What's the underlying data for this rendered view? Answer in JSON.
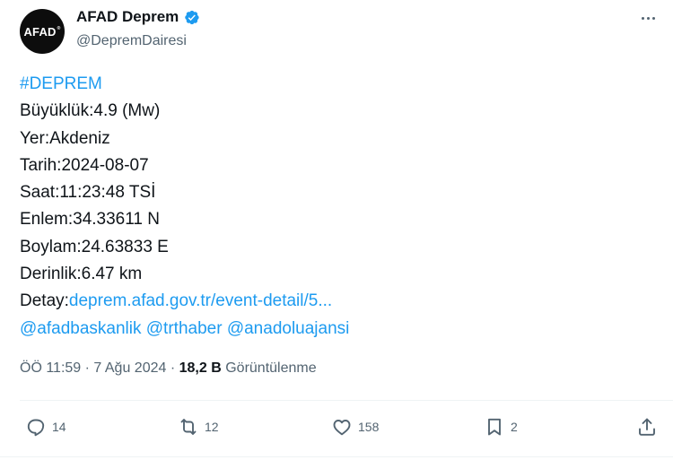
{
  "author": {
    "avatar_text": "AFAD",
    "avatar_mark": "®",
    "name": "AFAD Deprem",
    "handle": "@DepremDairesi",
    "verified_color": "#1d9bf0"
  },
  "tweet": {
    "hashtag": "#DEPREM",
    "lines": [
      "Büyüklük:4.9 (Mw)",
      "Yer:Akdeniz",
      "Tarih:2024-08-07",
      "Saat:11:23:48 TSİ",
      "Enlem:34.33611 N",
      "Boylam:24.63833 E",
      "Derinlik:6.47 km"
    ],
    "detail_label": "Detay:",
    "detail_link": "deprem.afad.gov.tr/event-detail/5...",
    "mentions": [
      "@afadbaskanlik",
      "@trthaber",
      "@anadoluajansi"
    ]
  },
  "meta": {
    "time": "ÖÖ 11:59",
    "separator": "·",
    "date": "7 Ağu 2024",
    "views_count": "18,2 B",
    "views_label": "Görüntülenme"
  },
  "actions": {
    "replies": "14",
    "reposts": "12",
    "likes": "158",
    "bookmarks": "2"
  },
  "colors": {
    "link": "#1d9bf0",
    "secondary_text": "#536471",
    "primary_text": "#0f1419"
  }
}
